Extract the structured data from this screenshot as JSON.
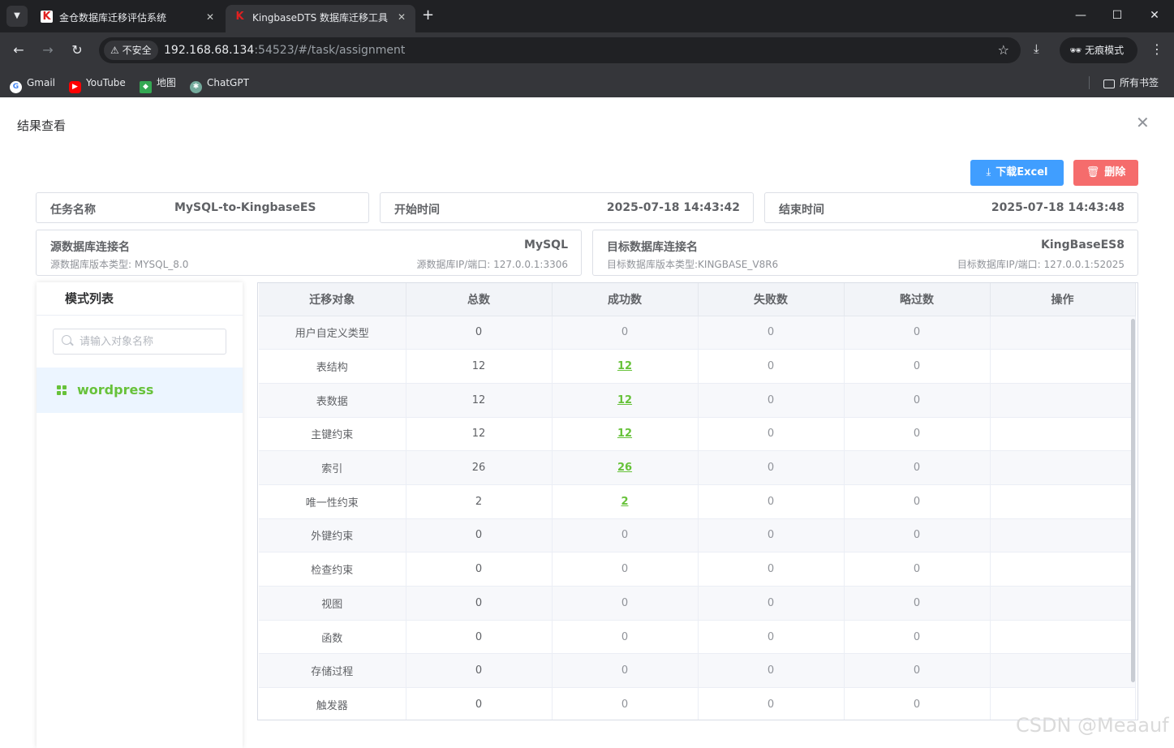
{
  "browser": {
    "tabs": [
      {
        "title": "金仓数据库迁移评估系统",
        "active": false
      },
      {
        "title": "KingbaseDTS 数据库迁移工具",
        "active": true
      }
    ],
    "security_label": "不安全",
    "url_host": "192.168.68.134",
    "url_rest": ":54523/#/task/assignment",
    "incognito_label": "无痕模式",
    "bookmarks": [
      "Gmail",
      "YouTube",
      "地图",
      "ChatGPT"
    ],
    "all_bookmarks_label": "所有书签"
  },
  "dialog": {
    "title": "结果查看",
    "download_label": "下载Excel",
    "delete_label": "删除"
  },
  "info": {
    "task_name_label": "任务名称",
    "task_name": "MySQL-to-KingbaseES",
    "start_label": "开始时间",
    "start_time": "2025-07-18 14:43:42",
    "end_label": "结束时间",
    "end_time": "2025-07-18 14:43:48",
    "source": {
      "label": "源数据库连接名",
      "name": "MySQL",
      "version_label": "源数据库版本类型:",
      "version": "MYSQL_8.0",
      "ip_label": "源数据库IP/端口:",
      "ip": "127.0.0.1:3306"
    },
    "target": {
      "label": "目标数据库连接名",
      "name": "KingBaseES8",
      "version_label": "目标数据库版本类型:",
      "version": "KINGBASE_V8R6",
      "ip_label": "目标数据库IP/端口:",
      "ip": "127.0.0.1:52025"
    }
  },
  "schema_list": {
    "title": "模式列表",
    "search_placeholder": "请输入对象名称",
    "items": [
      "wordpress"
    ]
  },
  "table": {
    "headers": [
      "迁移对象",
      "总数",
      "成功数",
      "失败数",
      "略过数",
      "操作"
    ],
    "rows": [
      {
        "object": "用户自定义类型",
        "total": "0",
        "success": "0",
        "failed": "0",
        "skipped": "0"
      },
      {
        "object": "表结构",
        "total": "12",
        "success": "12",
        "failed": "0",
        "skipped": "0"
      },
      {
        "object": "表数据",
        "total": "12",
        "success": "12",
        "failed": "0",
        "skipped": "0"
      },
      {
        "object": "主键约束",
        "total": "12",
        "success": "12",
        "failed": "0",
        "skipped": "0"
      },
      {
        "object": "索引",
        "total": "26",
        "success": "26",
        "failed": "0",
        "skipped": "0"
      },
      {
        "object": "唯一性约束",
        "total": "2",
        "success": "2",
        "failed": "0",
        "skipped": "0"
      },
      {
        "object": "外键约束",
        "total": "0",
        "success": "0",
        "failed": "0",
        "skipped": "0"
      },
      {
        "object": "检查约束",
        "total": "0",
        "success": "0",
        "failed": "0",
        "skipped": "0"
      },
      {
        "object": "视图",
        "total": "0",
        "success": "0",
        "failed": "0",
        "skipped": "0"
      },
      {
        "object": "函数",
        "total": "0",
        "success": "0",
        "failed": "0",
        "skipped": "0"
      },
      {
        "object": "存储过程",
        "total": "0",
        "success": "0",
        "failed": "0",
        "skipped": "0"
      },
      {
        "object": "触发器",
        "total": "0",
        "success": "0",
        "failed": "0",
        "skipped": "0"
      }
    ]
  },
  "watermark": "CSDN @Meaauf",
  "colors": {
    "primary": "#409eff",
    "danger": "#f56c6c",
    "success": "#67c23a"
  }
}
